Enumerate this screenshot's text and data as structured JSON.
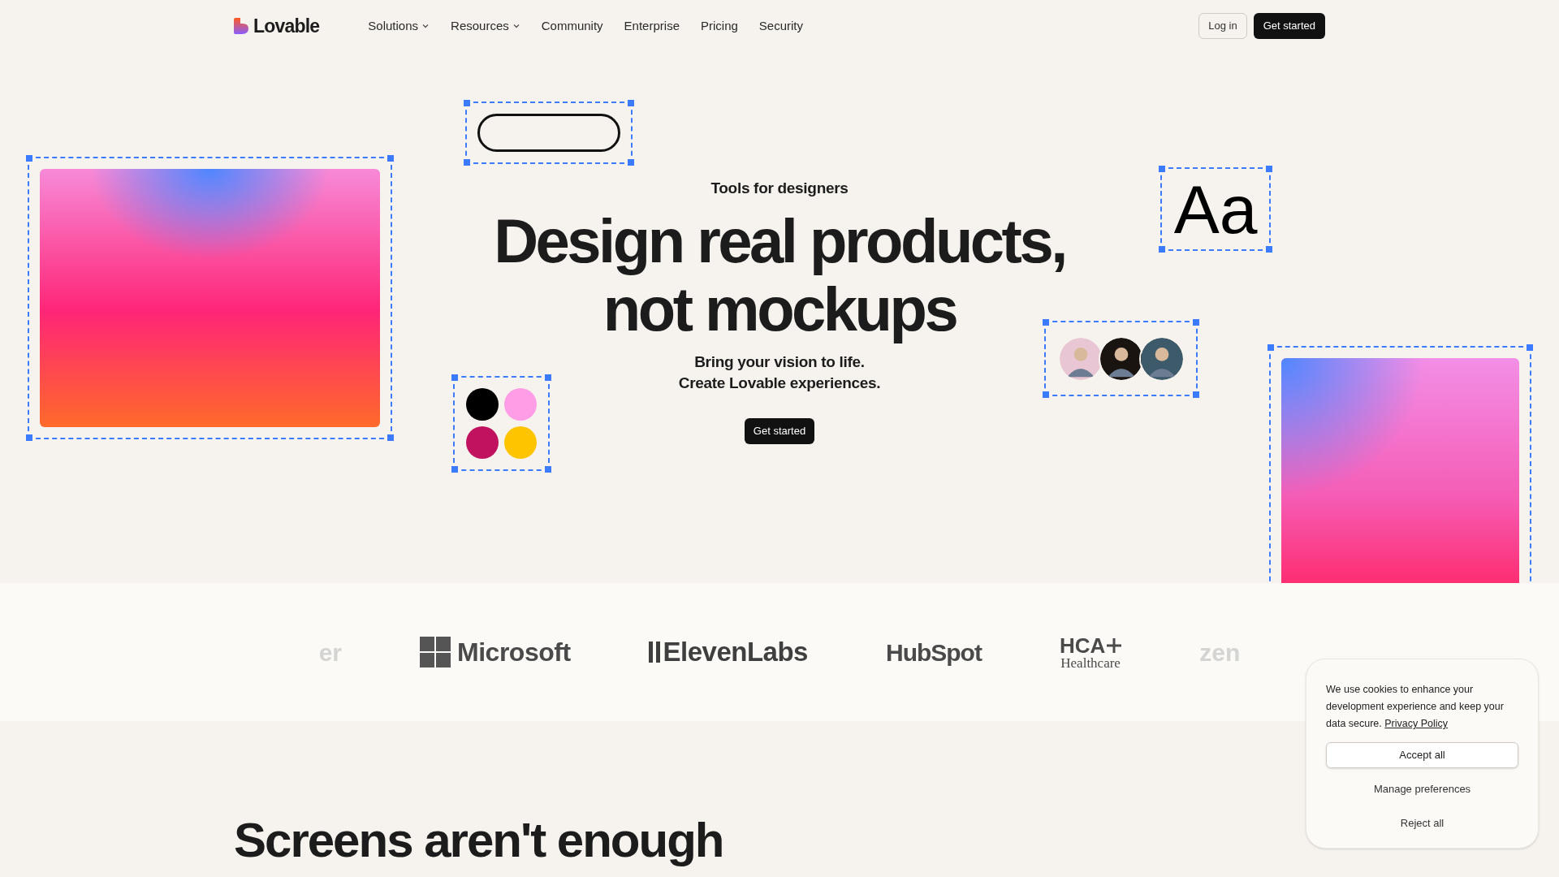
{
  "nav": {
    "logo": "Lovable",
    "items": [
      {
        "label": "Solutions",
        "dropdown": true
      },
      {
        "label": "Resources",
        "dropdown": true
      },
      {
        "label": "Community",
        "dropdown": false
      },
      {
        "label": "Enterprise",
        "dropdown": false
      },
      {
        "label": "Pricing",
        "dropdown": false
      },
      {
        "label": "Security",
        "dropdown": false
      }
    ],
    "login": "Log in",
    "cta": "Get started"
  },
  "hero": {
    "eyebrow": "Tools for designers",
    "title_lines": [
      "Design real products,",
      "not mockups"
    ],
    "subtitle_lines": [
      "Bring your vision to life.",
      "Create Lovable experiences."
    ],
    "cta": "Get started"
  },
  "canvas": {
    "sample_text": "Aa",
    "swatches": [
      {
        "color": "#000000"
      },
      {
        "color": "#ff9ee6"
      },
      {
        "color": "#c0125f"
      },
      {
        "color": "#ffc400"
      }
    ]
  },
  "logos": [
    {
      "kind": "partial",
      "name": "er"
    },
    {
      "kind": "microsoft",
      "name": "Microsoft"
    },
    {
      "kind": "elevenlabs",
      "name": "ElevenLabs"
    },
    {
      "kind": "hubspot",
      "name": "HubSpot"
    },
    {
      "kind": "hca",
      "name": "HCA",
      "sub": "Healthcare"
    },
    {
      "kind": "partial",
      "name": "zen"
    }
  ],
  "section": {
    "title": "Screens aren't enough"
  },
  "cookie": {
    "text": "We use cookies to enhance your development experience and keep your data secure.",
    "link": "Privacy Policy",
    "accept": "Accept all",
    "manage": "Manage preferences",
    "reject": "Reject all"
  }
}
